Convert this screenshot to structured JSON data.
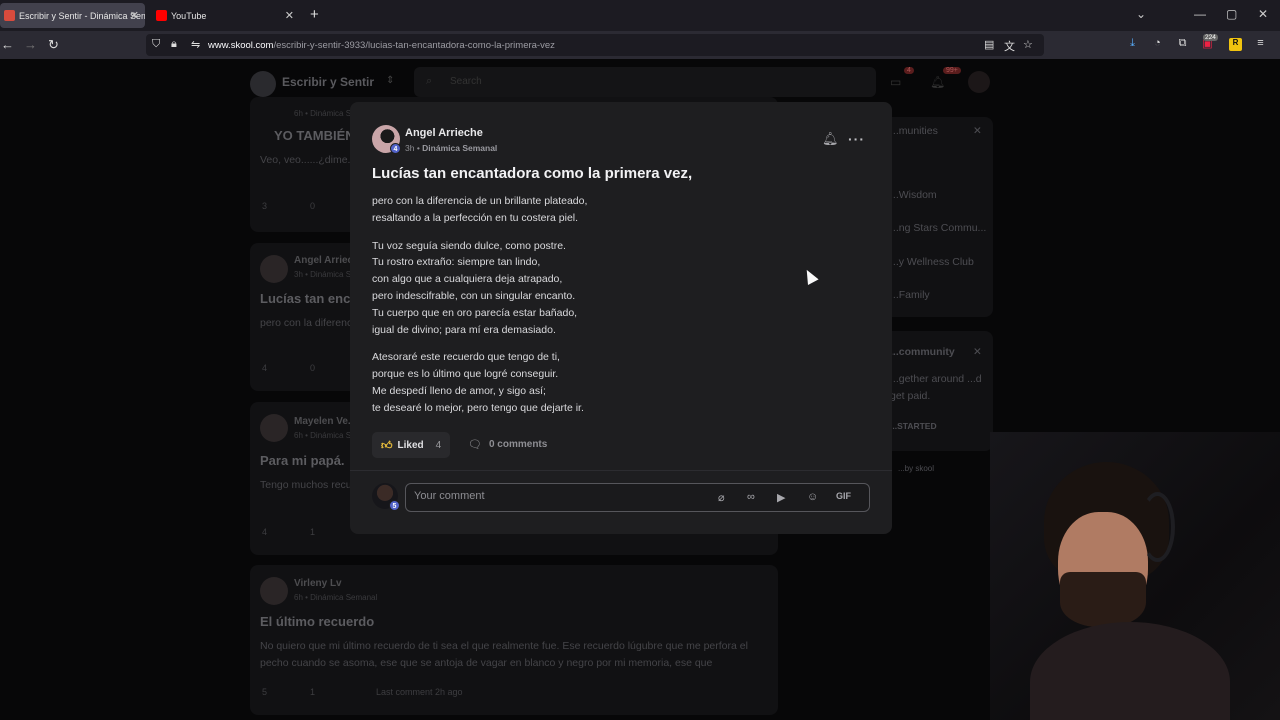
{
  "browser": {
    "tabs": [
      {
        "title": "Escribir y Sentir - Dinámica Sem",
        "active": true,
        "favicon_color": "#d94b3d"
      },
      {
        "title": "YouTube",
        "active": false,
        "favicon_color": "#ff0000"
      }
    ],
    "url_domain": "www.skool.com",
    "url_path": "/escribir-y-sentir-3933/lucias-tan-encantadora-como-la-primera-vez",
    "badges": {
      "extension_count": "224"
    }
  },
  "background": {
    "site_title": "Escribir y Sentir",
    "search_placeholder": "Search",
    "header_badges": {
      "chat": "4",
      "notifications": "99+"
    },
    "posts": [
      {
        "author": "",
        "meta": "6h • Dinámica Semanal",
        "title": "YO TAMBIÉN",
        "body": "Veo, veo......¿dime... destinatario. La m...",
        "likes": "3",
        "comments": "0"
      },
      {
        "author": "Angel Arrieche",
        "meta": "3h • Dinámica Semanal",
        "title": "Lucías tan enc...",
        "body": "pero con la diferencia... seguía siendo dulc...",
        "likes": "4",
        "comments": "0"
      },
      {
        "author": "Mayelen Ve...",
        "meta": "6h • Dinámica Semanal",
        "title": "Para mi papá.",
        "body": "Tengo muchos recu... que yo quise que f...",
        "likes": "4",
        "comments": "1"
      },
      {
        "author": "Virleny Lv",
        "meta": "6h • Dinámica Semanal",
        "title": "El último recuerdo",
        "body": "No quiero que mi último recuerdo de ti sea el que realmente fue. Ese recuerdo lúgubre que me perfora el pecho cuando se asoma, ese que se antoja de vagar en blanco y negro por mi memoria, ese que",
        "likes": "5",
        "comments": "1",
        "last_comment": "Last comment 2h ago"
      }
    ],
    "right_panel": {
      "header": "...munities",
      "items": [
        "...Wisdom",
        "...ng Stars Commu...",
        "...y Wellness Club",
        "...Family"
      ],
      "promo_title": "...community",
      "promo_body": "...gether around ...d get paid.",
      "promo_cta": "...STARTED",
      "powered": "...by skool"
    }
  },
  "modal": {
    "author": "Angel Arrieche",
    "level": "4",
    "time": "3h",
    "category": "Dinámica Semanal",
    "title": "Lucías tan encantadora como la primera vez,",
    "stanzas": [
      [
        "pero con la diferencia de un brillante plateado,",
        "resaltando a la perfección en tu costera piel."
      ],
      [
        "Tu voz seguía siendo dulce, como postre.",
        "Tu rostro extraño: siempre tan lindo,",
        "con algo que a cualquiera deja atrapado,",
        "pero indescifrable, con un singular encanto.",
        "Tu cuerpo que en oro parecía estar bañado,",
        "igual de divino; para mí era demasiado."
      ],
      [
        "Atesoraré este recuerdo que tengo de ti,",
        "porque es lo último que logré conseguir.",
        "Me despedí lleno de amor, y sigo así;",
        "te desearé lo mejor, pero tengo que dejarte ir."
      ]
    ],
    "like_label": "Liked",
    "like_count": "4",
    "comments_label": "0 comments",
    "comment_placeholder": "Your comment",
    "commenter_level": "5",
    "gif_label": "GIF"
  }
}
